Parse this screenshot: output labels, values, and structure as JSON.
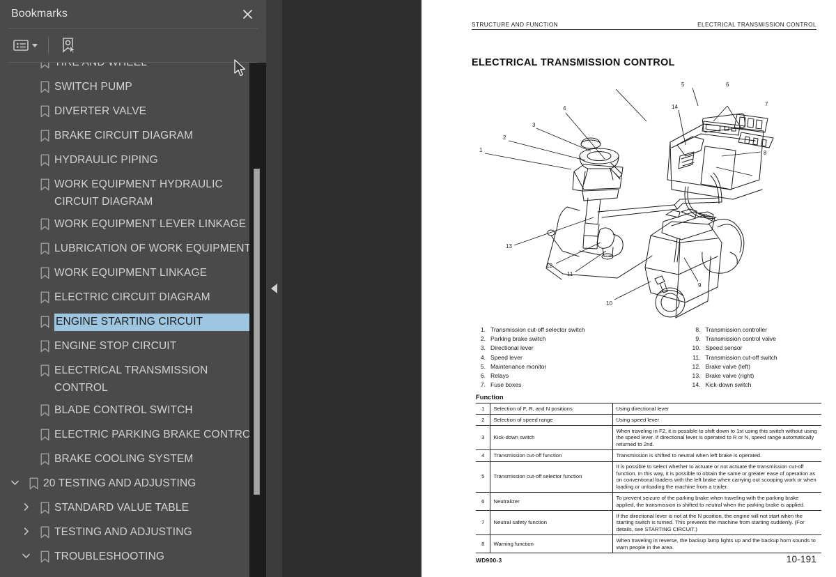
{
  "panel": {
    "title": "Bookmarks",
    "close_icon": "close-icon",
    "toolbar": {
      "options_icon": "list-options-icon",
      "options_caret_icon": "chevron-down-icon",
      "new_bookmark_icon": "new-bookmark-icon"
    }
  },
  "bookmarks": [
    {
      "label": "TIRE AND WHEEL",
      "depth": 1,
      "twisty": "none",
      "selected": false
    },
    {
      "label": "SWITCH PUMP",
      "depth": 1,
      "twisty": "none",
      "selected": false
    },
    {
      "label": "DIVERTER VALVE",
      "depth": 1,
      "twisty": "none",
      "selected": false
    },
    {
      "label": "BRAKE CIRCUIT DIAGRAM",
      "depth": 1,
      "twisty": "none",
      "selected": false
    },
    {
      "label": "HYDRAULIC PIPING",
      "depth": 1,
      "twisty": "none",
      "selected": false
    },
    {
      "label": "WORK EQUIPMENT HYDRAULIC CIRCUIT DIAGRAM",
      "depth": 1,
      "twisty": "none",
      "selected": false
    },
    {
      "label": "WORK EQUIPMENT LEVER LINKAGE",
      "depth": 1,
      "twisty": "none",
      "selected": false
    },
    {
      "label": "LUBRICATION OF WORK EQUIPMENT",
      "depth": 1,
      "twisty": "none",
      "selected": false
    },
    {
      "label": "WORK EQUIPMENT LINKAGE",
      "depth": 1,
      "twisty": "none",
      "selected": false
    },
    {
      "label": "ELECTRIC CIRCUIT DIAGRAM",
      "depth": 1,
      "twisty": "none",
      "selected": false
    },
    {
      "label": "ENGINE STARTING CIRCUIT",
      "depth": 1,
      "twisty": "none",
      "selected": true
    },
    {
      "label": "ENGINE STOP CIRCUIT",
      "depth": 1,
      "twisty": "none",
      "selected": false
    },
    {
      "label": "ELECTRICAL TRANSMISSION CONTROL",
      "depth": 1,
      "twisty": "none",
      "selected": false
    },
    {
      "label": "BLADE CONTROL SWITCH",
      "depth": 1,
      "twisty": "none",
      "selected": false
    },
    {
      "label": "ELECTRIC PARKING BRAKE CONTROL",
      "depth": 1,
      "twisty": "none",
      "selected": false
    },
    {
      "label": "BRAKE COOLING SYSTEM",
      "depth": 1,
      "twisty": "none",
      "selected": false
    },
    {
      "label": "20 TESTING AND ADJUSTING",
      "depth": 0,
      "twisty": "expanded",
      "selected": false
    },
    {
      "label": "STANDARD VALUE TABLE",
      "depth": 1,
      "twisty": "collapsed",
      "selected": false
    },
    {
      "label": "TESTING AND ADJUSTING",
      "depth": 1,
      "twisty": "collapsed",
      "selected": false
    },
    {
      "label": "TROUBLESHOOTING",
      "depth": 1,
      "twisty": "expanded",
      "selected": false
    }
  ],
  "colors": {
    "panel_bg": "#4a4a4a",
    "selection": "#9fc6e0",
    "scrollbar_track": "#1c1c1c",
    "scrollbar_thumb": "#a6a6a6",
    "text": "#d2d2d2"
  },
  "collapse_handle": {
    "icon": "chevron-left-icon"
  },
  "document": {
    "running_head_left": "STRUCTURE AND FUNCTION",
    "running_head_right": "ELECTRICAL TRANSMISSION CONTROL",
    "heading": "ELECTRICAL TRANSMISSION CONTROL",
    "figure_callouts": [
      "1",
      "2",
      "3",
      "4",
      "5",
      "6",
      "7",
      "8",
      "9",
      "10",
      "11",
      "12",
      "13",
      "14"
    ],
    "parts_left": [
      {
        "num": "1.",
        "name": "Transmission cut-off selector switch"
      },
      {
        "num": "2.",
        "name": "Parking brake switch"
      },
      {
        "num": "3.",
        "name": "Directional lever"
      },
      {
        "num": "4.",
        "name": "Speed lever"
      },
      {
        "num": "5.",
        "name": "Maintenance monitor"
      },
      {
        "num": "6.",
        "name": "Relays"
      },
      {
        "num": "7.",
        "name": "Fuse boxes"
      }
    ],
    "parts_right": [
      {
        "num": "8.",
        "name": "Transmission controller"
      },
      {
        "num": "9.",
        "name": "Transmission control valve"
      },
      {
        "num": "10.",
        "name": "Speed sensor"
      },
      {
        "num": "11.",
        "name": "Transmission cut-off switch"
      },
      {
        "num": "12.",
        "name": "Brake valve (left)"
      },
      {
        "num": "13.",
        "name": "Brake valve (right)"
      },
      {
        "num": "14.",
        "name": "Kick-down switch"
      }
    ],
    "function_title": "Function",
    "function_rows": [
      {
        "no": "1",
        "name": "Selection of F, R, and N positions",
        "desc": "Using directional lever"
      },
      {
        "no": "2",
        "name": "Selection of speed range",
        "desc": "Using speed lever"
      },
      {
        "no": "3",
        "name": "Kick-down switch",
        "desc": "When traveling in F2, it is possible to shift down to 1st using this switch without using the speed lever. If directional lever is operated to R or N, speed range automatically returned to 2nd."
      },
      {
        "no": "4",
        "name": "Transmission cut-off function",
        "desc": "Transmission is shifted to neutral when left brake is operated."
      },
      {
        "no": "5",
        "name": "Transmission cut-off selector function",
        "desc": "It is possible to select whether to actuate or not actuate the transmission cut-off function. In this way, it is possible to obtain the same or greater ease of operation as on conventional loaders with the left brake when carrying out scooping work or when loading or unloading the machine from a trailer."
      },
      {
        "no": "6",
        "name": "Neutralizer",
        "desc": "To prevent seizure of the parking brake when traveling with the parking brake applied, the transmission is shifted to neutral when the parking brake is applied."
      },
      {
        "no": "7",
        "name": "Neutral safety function",
        "desc": "If the directional lever is not at the N position, the engine will not start when the starting switch is turned. This prevents the machine from starting suddenly. (For details, see STARTING CIRCUIT.)"
      },
      {
        "no": "8",
        "name": "Warning function",
        "desc": "When traveling in reverse, the backup lamp lights up and the backup horn sounds to warn people in the area."
      }
    ],
    "footer_model": "WD900-3",
    "footer_page": "10-191"
  }
}
